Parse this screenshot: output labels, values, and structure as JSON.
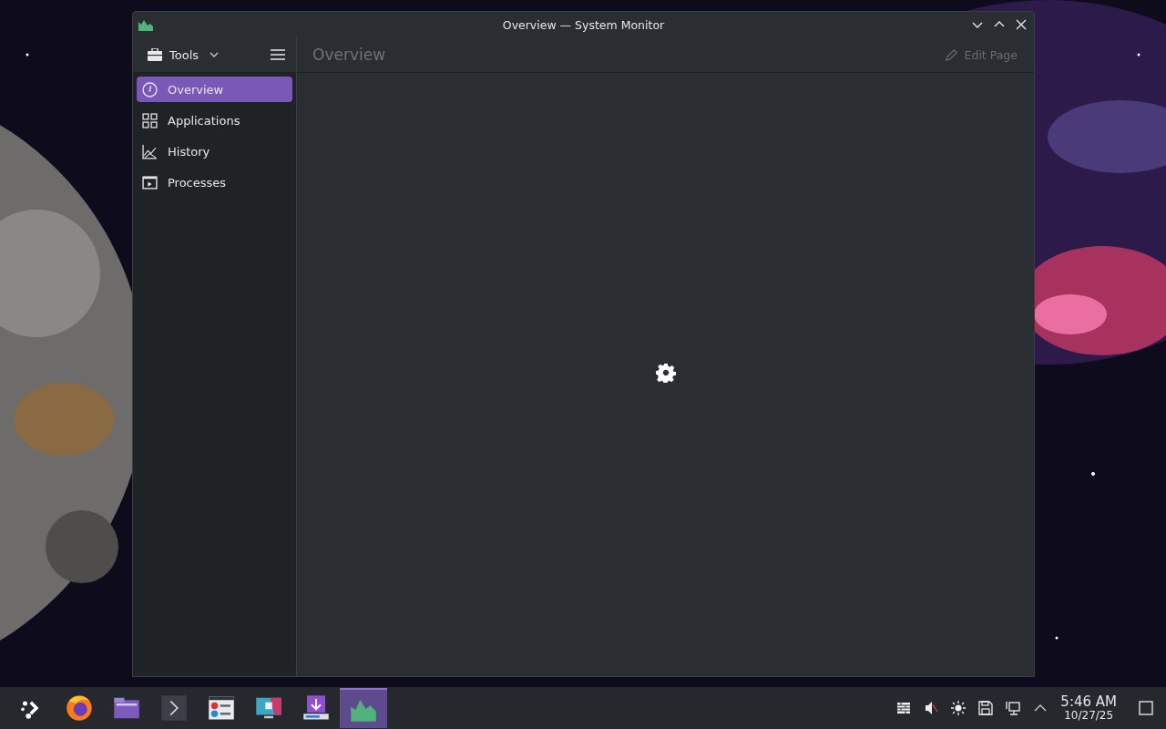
{
  "window": {
    "title": "Overview — System Monitor",
    "tools_button": "Tools",
    "page_title": "Overview",
    "edit_button": {
      "label": "Edit Page",
      "disabled": true
    }
  },
  "sidebar": {
    "items": [
      {
        "label": "Overview",
        "kind": "gauge",
        "selected": true
      },
      {
        "label": "Applications",
        "kind": "grid",
        "selected": false
      },
      {
        "label": "History",
        "kind": "chart",
        "selected": false
      },
      {
        "label": "Processes",
        "kind": "terminal",
        "selected": false
      }
    ]
  },
  "taskbar": {
    "apps": [
      {
        "kind": "launcher",
        "selected": false
      },
      {
        "kind": "browser",
        "selected": false
      },
      {
        "kind": "folder",
        "selected": false
      },
      {
        "kind": "terminal",
        "selected": false
      },
      {
        "kind": "settings",
        "selected": false
      },
      {
        "kind": "display",
        "selected": false
      },
      {
        "kind": "download",
        "selected": false
      },
      {
        "kind": "monitor",
        "selected": true
      }
    ],
    "tray": [
      {
        "kind": "firewall"
      },
      {
        "kind": "mute"
      },
      {
        "kind": "brightness"
      },
      {
        "kind": "disk"
      },
      {
        "kind": "network"
      },
      {
        "kind": "expand"
      }
    ],
    "clock": {
      "time": "5:46 AM",
      "date": "10/27/25"
    }
  }
}
